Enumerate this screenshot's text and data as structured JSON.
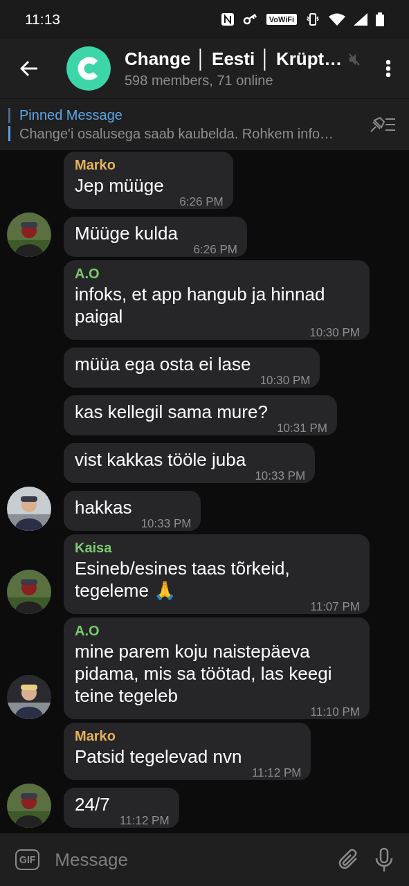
{
  "status_bar": {
    "time": "11:13",
    "wifi_badge": "VoWiFi"
  },
  "header": {
    "title": "Change │ Eesti │ Krüpt…",
    "muted": true,
    "subtitle": "598 members, 71 online"
  },
  "pinned": {
    "label": "Pinned Message",
    "text": "Change'i osalusega saab kaubelda. Rohkem info…"
  },
  "messages": [
    {
      "sender": "Marko",
      "color": "#e5b25a",
      "text": "Jep müüge",
      "time": "6:26 PM",
      "avatar": false
    },
    {
      "text": "Müüge kulda",
      "time": "6:26 PM",
      "avatar": true
    },
    {
      "sender": "A.O",
      "color": "#7ccb6e",
      "text": "infoks, et app hangub ja hinnad paigal",
      "time": "10:30 PM",
      "avatar": false
    },
    {
      "text": "müüa ega osta ei lase",
      "time": "10:30 PM",
      "avatar": false
    },
    {
      "text": "kas kellegil sama mure?",
      "time": "10:31 PM",
      "avatar": false
    },
    {
      "text": "vist kakkas tööle juba",
      "time": "10:33 PM",
      "avatar": false
    },
    {
      "text": "hakkas",
      "time": "10:33 PM",
      "avatar": true
    },
    {
      "sender": "Kaisa",
      "color": "#7ccb6e",
      "text": "Esineb/esines taas tõrkeid, tegeleme 🙏",
      "time": "11:07 PM",
      "avatar": true
    },
    {
      "sender": "A.O",
      "color": "#7ccb6e",
      "text": "mine parem koju naistepäeva pidama, mis sa töötad, las keegi teine tegeleb",
      "time": "11:10 PM",
      "avatar": true
    },
    {
      "sender": "Marko",
      "color": "#e5b25a",
      "text": "Patsid tegelevad nvn",
      "time": "11:12 PM",
      "avatar": false
    },
    {
      "text": "24/7",
      "time": "11:12 PM",
      "avatar": true
    }
  ],
  "composer": {
    "gif": "GIF",
    "placeholder": "Message"
  }
}
